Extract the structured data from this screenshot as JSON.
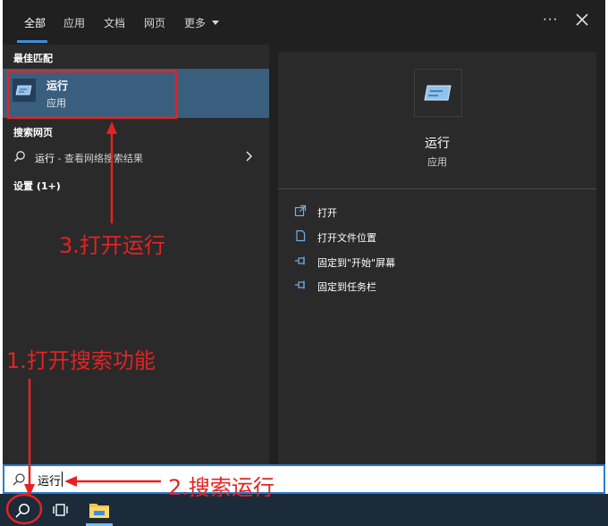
{
  "tabs": {
    "all": "全部",
    "apps": "应用",
    "docs": "文档",
    "web": "网页",
    "more": "更多"
  },
  "window": {
    "ellipsis": "···"
  },
  "left": {
    "best_match_title": "最佳匹配",
    "best_match_name": "运行",
    "best_match_type": "应用",
    "web_section_title": "搜索网页",
    "web_item_main": "运行",
    "web_item_sub": " - 查看网络搜索结果",
    "settings_title": "设置 (1+)"
  },
  "detail": {
    "title": "运行",
    "subtitle": "应用",
    "actions": [
      {
        "label": "打开",
        "icon": "open-icon"
      },
      {
        "label": "打开文件位置",
        "icon": "file-location-icon"
      },
      {
        "label": "固定到\"开始\"屏幕",
        "icon": "pin-icon"
      },
      {
        "label": "固定到任务栏",
        "icon": "pin-icon"
      }
    ]
  },
  "search": {
    "value": "运行"
  },
  "taskbar": {
    "icons": [
      "search-icon",
      "task-view-icon",
      "file-explorer-icon"
    ]
  },
  "annotations": {
    "step1": "1.打开搜索功能",
    "step2": "2.搜索运行",
    "step3": "3.打开运行",
    "color": "#e52222"
  },
  "colors": {
    "panel": "#202020",
    "column": "#2a2a2a",
    "selected_row": "#3a5f7e",
    "accent": "#3b8fd9",
    "taskbar": "#1c2b3a"
  }
}
